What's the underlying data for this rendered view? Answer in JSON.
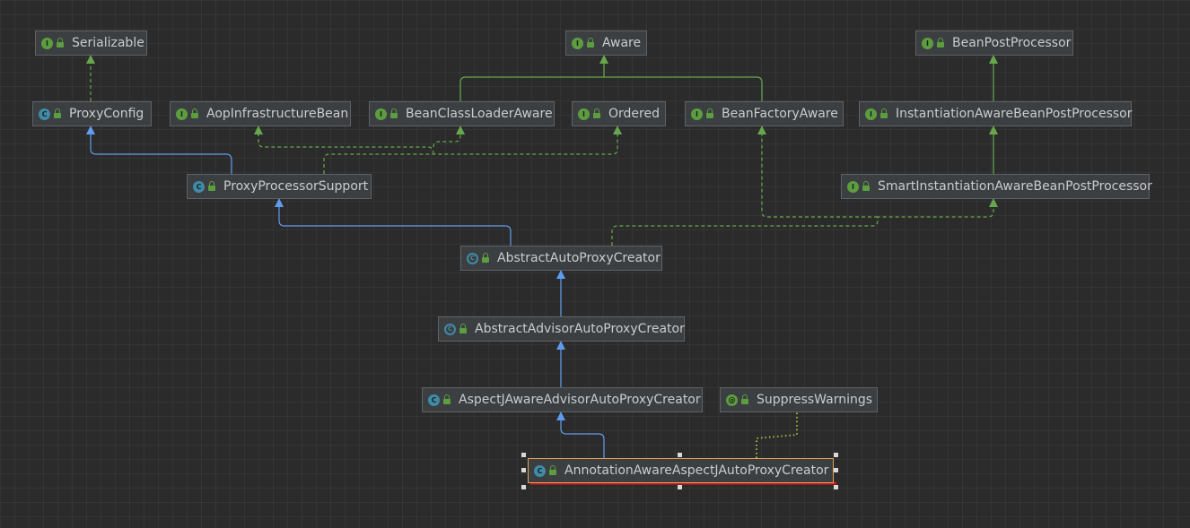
{
  "nodes": {
    "serializable": {
      "label": "Serializable",
      "kind": "I"
    },
    "aware": {
      "label": "Aware",
      "kind": "I"
    },
    "bean_post_processor": {
      "label": "BeanPostProcessor",
      "kind": "I"
    },
    "proxy_config": {
      "label": "ProxyConfig",
      "kind": "C"
    },
    "aop_infrastructure_bean": {
      "label": "AopInfrastructureBean",
      "kind": "I"
    },
    "bean_class_loader_aware": {
      "label": "BeanClassLoaderAware",
      "kind": "I"
    },
    "ordered": {
      "label": "Ordered",
      "kind": "I"
    },
    "bean_factory_aware": {
      "label": "BeanFactoryAware",
      "kind": "I"
    },
    "instantiation_aware_bpp": {
      "label": "InstantiationAwareBeanPostProcessor",
      "kind": "I"
    },
    "proxy_processor_support": {
      "label": "ProxyProcessorSupport",
      "kind": "C"
    },
    "smart_instantiation_aware_bpp": {
      "label": "SmartInstantiationAwareBeanPostProcessor",
      "kind": "I"
    },
    "abstract_auto_proxy_creator": {
      "label": "AbstractAutoProxyCreator",
      "kind": "C"
    },
    "abstract_advisor_auto_proxy_creator": {
      "label": "AbstractAdvisorAutoProxyCreator",
      "kind": "C"
    },
    "aspectj_aware_advisor_auto_proxy_creator": {
      "label": "AspectJAwareAdvisorAutoProxyCreator",
      "kind": "C"
    },
    "suppress_warnings": {
      "label": "SuppressWarnings",
      "kind": "@"
    },
    "annotation_aware_aspectj_auto_proxy_creator": {
      "label": "AnnotationAwareAspectJAutoProxyCreator",
      "kind": "C"
    }
  },
  "colors": {
    "background": "#2b2b2b",
    "extends_edge": "#5f9cf0",
    "implements_edge": "#67a84e",
    "highlight_underline": "#e0151a",
    "selected_border": "#e3a356"
  }
}
